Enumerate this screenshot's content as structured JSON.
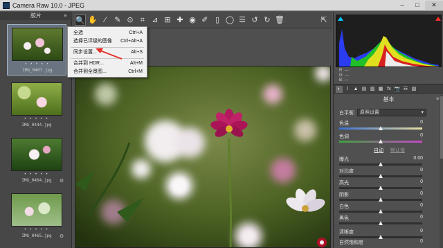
{
  "window": {
    "title": "Camera Raw 10.0 - JPEG",
    "controls": {
      "minimize": "–",
      "maximize": "□",
      "close": "✕"
    }
  },
  "filmstrip": {
    "header": "胶片",
    "menu_icon": "≡",
    "items": [
      {
        "name": "IMG_0407.jpg",
        "stars": "• • • • •",
        "selected": true
      },
      {
        "name": "IMG_0444.jpg",
        "stars": "• • • • •",
        "selected": false
      },
      {
        "name": "IMG_0464.jpg",
        "stars": "• • • • •",
        "selected": false
      },
      {
        "name": "IMG_0465.jpg",
        "stars": "• • • • •",
        "selected": false
      }
    ]
  },
  "toolbar": {
    "tools": [
      {
        "name": "zoom-tool-icon",
        "glyph": "🔍"
      },
      {
        "name": "hand-tool-icon",
        "glyph": "✋"
      },
      {
        "name": "white-balance-icon",
        "glyph": "⁄"
      },
      {
        "name": "color-sampler-icon",
        "glyph": "✎"
      },
      {
        "name": "targeted-adjust-icon",
        "glyph": "⊙"
      },
      {
        "name": "crop-tool-icon",
        "glyph": "⌗"
      },
      {
        "name": "straighten-icon",
        "glyph": "⊿"
      },
      {
        "name": "transform-icon",
        "glyph": "⊞"
      },
      {
        "name": "spot-removal-icon",
        "glyph": "✚"
      },
      {
        "name": "red-eye-icon",
        "glyph": "◉"
      },
      {
        "name": "adjust-brush-icon",
        "glyph": "✐"
      },
      {
        "name": "graduated-filter-icon",
        "glyph": "▯"
      },
      {
        "name": "radial-filter-icon",
        "glyph": "◯"
      },
      {
        "name": "preferences-icon",
        "glyph": "☰"
      },
      {
        "name": "rotate-ccw-icon",
        "glyph": "↺"
      },
      {
        "name": "rotate-cw-icon",
        "glyph": "↻"
      },
      {
        "name": "trash-icon",
        "glyph": "🗑"
      }
    ],
    "right_tool": {
      "name": "open-in-photoshop-icon",
      "glyph": "⇱"
    }
  },
  "context_menu": {
    "items": [
      {
        "label": "全选",
        "shortcut": "Ctrl+A"
      },
      {
        "label": "选择已评级的图像",
        "shortcut": "Ctrl+Alt+A"
      },
      {
        "label": "同步设置...",
        "shortcut": "Alt+S"
      },
      {
        "label": "合并到 HDR...",
        "shortcut": "Alt+M"
      },
      {
        "label": "合并到全景图...",
        "shortcut": "Ctrl+M"
      }
    ]
  },
  "histogram": {
    "readouts": [
      "R: ---",
      "G: ---",
      "B: ---"
    ],
    "shadow_clip_color": "#00c8ff",
    "highlight_clip_color": "#ff3030"
  },
  "panel_tabs": [
    {
      "name": "basic-tab-icon",
      "glyph": "◐",
      "active": true
    },
    {
      "name": "tone-curve-tab-icon",
      "glyph": "⌇",
      "active": false
    },
    {
      "name": "detail-tab-icon",
      "glyph": "▲",
      "active": false
    },
    {
      "name": "hsl-tab-icon",
      "glyph": "▤",
      "active": false
    },
    {
      "name": "split-toning-tab-icon",
      "glyph": "▥",
      "active": false
    },
    {
      "name": "lens-tab-icon",
      "glyph": "▦",
      "active": false
    },
    {
      "name": "effects-tab-icon",
      "glyph": "fx",
      "active": false
    },
    {
      "name": "camera-calibration-tab-icon",
      "glyph": "📷",
      "active": false
    },
    {
      "name": "presets-tab-icon",
      "glyph": "☷",
      "active": false
    },
    {
      "name": "snapshots-tab-icon",
      "glyph": "▨",
      "active": false
    }
  ],
  "basic": {
    "section_title": "基本",
    "menu_icon": "≡",
    "white_balance": {
      "label": "白平衡:",
      "value": "原照设置"
    },
    "temperature": {
      "label": "色温",
      "value": "0"
    },
    "tint": {
      "label": "色调",
      "value": "0"
    },
    "auto_label": "自动",
    "default_label": "默认值",
    "sliders": [
      {
        "label": "曝光",
        "value": "0.00"
      },
      {
        "label": "对比度",
        "value": "0"
      },
      {
        "label": "高光",
        "value": "0"
      },
      {
        "label": "阴影",
        "value": "0"
      },
      {
        "label": "白色",
        "value": "0"
      },
      {
        "label": "黑色",
        "value": "0"
      },
      {
        "label": "清晰度",
        "value": "0"
      },
      {
        "label": "自然饱和度",
        "value": "0"
      }
    ]
  }
}
